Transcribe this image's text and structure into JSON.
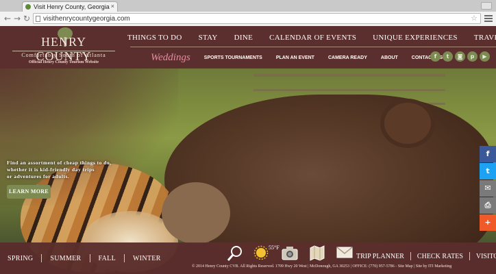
{
  "browser": {
    "tab_title": "Visit Henry County, Georgia",
    "url": "visithenrycountygeorgia.com"
  },
  "logo": {
    "name": "HENRY COUNTY",
    "tagline": "Comfortably South of Atlanta",
    "official": "Official Henry County Tourism Website"
  },
  "top_nav": [
    "THINGS TO DO",
    "STAY",
    "DINE",
    "CALENDAR OF EVENTS",
    "UNIQUE EXPERIENCES",
    "TRAVEL BLOG"
  ],
  "sub_nav": {
    "weddings": "Weddings",
    "items": [
      "SPORTS TOURNAMENTS",
      "PLAN AN EVENT",
      "CAMERA READY",
      "ABOUT",
      "CONTACT US"
    ]
  },
  "social_icons": [
    "facebook-icon",
    "twitter-icon",
    "instagram-icon",
    "pinterest-icon",
    "youtube-icon"
  ],
  "hero": {
    "line1": "Find an assortment of cheap things to do,",
    "line2": "whether it is kid-friendly day trips",
    "line3": "or adventures for adults.",
    "button": "LEARN MORE"
  },
  "share_rail": [
    {
      "icon": "facebook-icon",
      "color": "#3b5998",
      "glyph": "f"
    },
    {
      "icon": "twitter-icon",
      "color": "#1da1f2",
      "glyph": "t"
    },
    {
      "icon": "mail-icon",
      "color": "#7a7a7a",
      "glyph": "✉"
    },
    {
      "icon": "print-icon",
      "color": "#7a7a7a",
      "glyph": "⎙"
    },
    {
      "icon": "plus-icon",
      "color": "#f05a28",
      "glyph": "+"
    }
  ],
  "seasons": [
    "SPRING",
    "SUMMER",
    "FALL",
    "WINTER"
  ],
  "weather": {
    "temp": "55°F"
  },
  "footer_links": [
    "TRIP PLANNER",
    "CHECK RATES",
    "VISITORS GUIDE"
  ],
  "copyright": "© 2014 Henry County CVB. All Rights Reserved. 1709 Hwy 20 West | McDonough, GA 30253 | OFFICE: (770) 957-5786 - Site Map | Site by ITI Marketing",
  "colors": {
    "header_bg": "#5b2f2d",
    "accent_green": "#7d8b53",
    "weddings_pink": "#e78aa3"
  }
}
